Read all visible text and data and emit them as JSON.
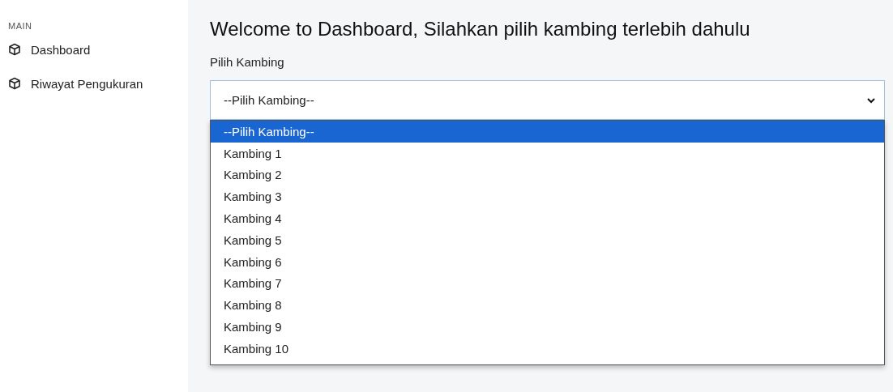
{
  "sidebar": {
    "section": "MAIN",
    "items": [
      {
        "label": "Dashboard",
        "selected": false
      },
      {
        "label": "Riwayat Pengukuran",
        "selected": false
      }
    ]
  },
  "main": {
    "title": "Welcome to Dashboard, Silahkan pilih kambing terlebih dahulu",
    "field_label": "Pilih Kambing",
    "select": {
      "value": "--Pilih Kambing--",
      "expanded": true,
      "options": [
        {
          "label": "--Pilih Kambing--",
          "selected": true
        },
        {
          "label": "Kambing 1",
          "selected": false
        },
        {
          "label": "Kambing 2",
          "selected": false
        },
        {
          "label": "Kambing 3",
          "selected": false
        },
        {
          "label": "Kambing 4",
          "selected": false
        },
        {
          "label": "Kambing 5",
          "selected": false
        },
        {
          "label": "Kambing 6",
          "selected": false
        },
        {
          "label": "Kambing 7",
          "selected": false
        },
        {
          "label": "Kambing 8",
          "selected": false
        },
        {
          "label": "Kambing 9",
          "selected": false
        },
        {
          "label": "Kambing 10",
          "selected": false
        }
      ]
    }
  }
}
